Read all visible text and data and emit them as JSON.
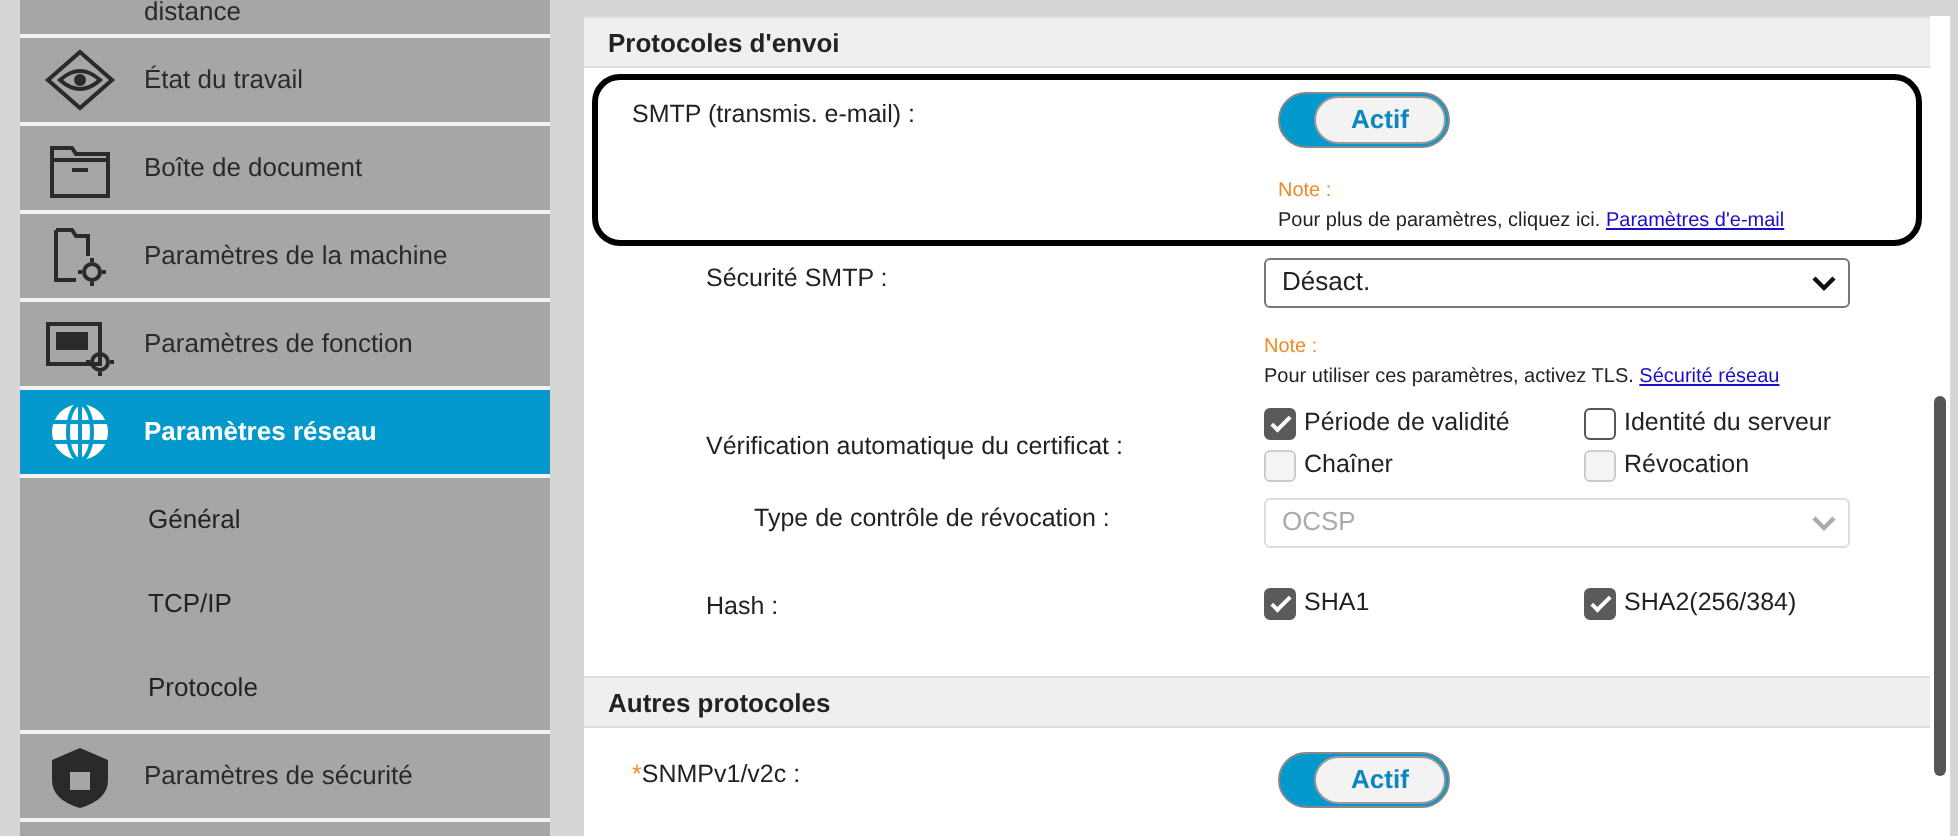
{
  "sidebar": {
    "items": [
      {
        "label": "distance",
        "selected": false
      },
      {
        "label": "État du travail",
        "selected": false
      },
      {
        "label": "Boîte de document",
        "selected": false
      },
      {
        "label": "Paramètres de la machine",
        "selected": false
      },
      {
        "label": "Paramètres de fonction",
        "selected": false
      },
      {
        "label": "Paramètres réseau",
        "selected": true,
        "children": [
          {
            "label": "Général",
            "selected": false
          },
          {
            "label": "TCP/IP",
            "selected": false
          },
          {
            "label": "Protocole",
            "selected": false
          }
        ]
      },
      {
        "label": "Paramètres de sécurité",
        "selected": false
      }
    ]
  },
  "sections": [
    {
      "title": "Protocoles d'envoi",
      "rows": [
        {
          "kind": "toggle",
          "label": "SMTP (transmis. e-mail) :",
          "highlighted": true,
          "value": "Actif",
          "on": true,
          "note": {
            "title": "Note :",
            "text": "Pour plus de paramètres, cliquez ici.",
            "link": "Paramètres d'e-mail"
          },
          "children": [
            {
              "kind": "select",
              "label": "Sécurité SMTP :",
              "value": "Désact.",
              "disabled": false,
              "note": {
                "title": "Note :",
                "text": "Pour utiliser ces paramètres, activez TLS.",
                "link": "Sécurité réseau"
              }
            },
            {
              "kind": "checkboxes",
              "label": "Vérification automatique du certificat :",
              "options": [
                {
                  "label": "Période de validité",
                  "checked": true,
                  "disabled": false
                },
                {
                  "label": "Identité du serveur",
                  "checked": false,
                  "disabled": false
                },
                {
                  "label": "Chaîner",
                  "checked": false,
                  "disabled": true
                },
                {
                  "label": "Révocation",
                  "checked": false,
                  "disabled": true
                }
              ],
              "children": [
                {
                  "kind": "select",
                  "label": "Type de contrôle de révocation :",
                  "value": "OCSP",
                  "disabled": true
                }
              ]
            },
            {
              "kind": "checkboxes",
              "label": "Hash :",
              "options": [
                {
                  "label": "SHA1",
                  "checked": true,
                  "disabled": false
                },
                {
                  "label": "SHA2(256/384)",
                  "checked": true,
                  "disabled": false
                }
              ]
            }
          ]
        }
      ]
    },
    {
      "title": "Autres protocoles",
      "rows": [
        {
          "kind": "toggle",
          "label": "SNMPv1/v2c :",
          "highlighted": false,
          "marker": "*",
          "value": "Actif",
          "on": true
        }
      ]
    }
  ]
}
